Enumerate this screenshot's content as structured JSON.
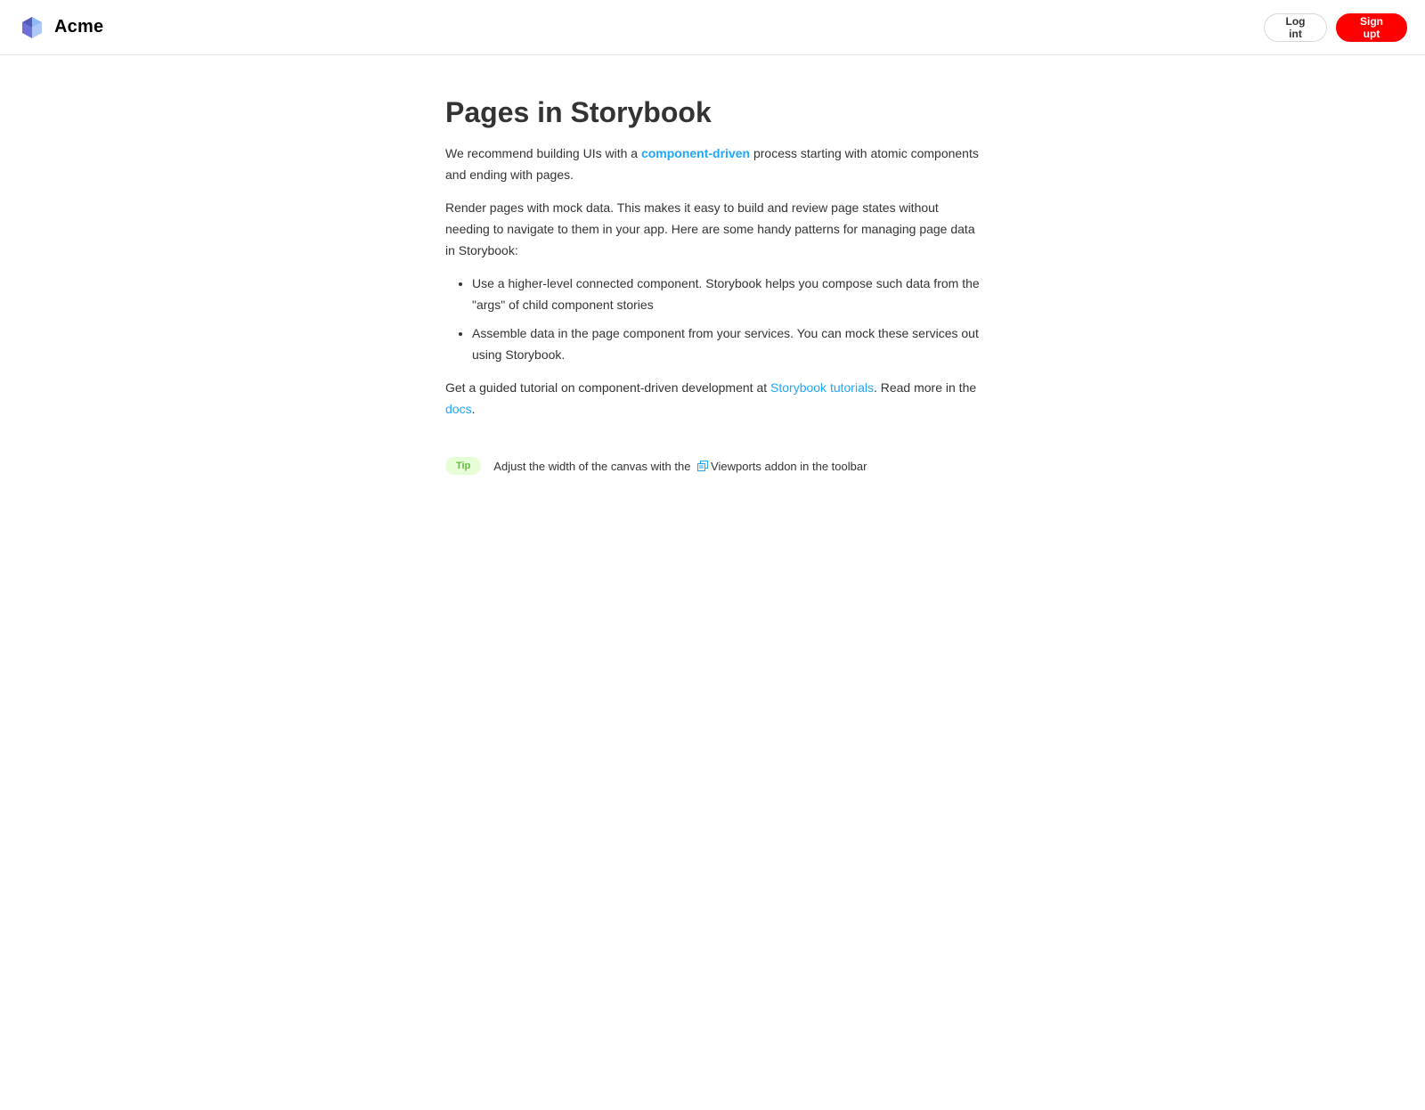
{
  "header": {
    "brand": "Acme",
    "logo_icon": "acme-cube-logo",
    "login_label": "Log int",
    "signup_label": "Sign upt"
  },
  "main": {
    "title": "Pages in Storybook",
    "intro": {
      "before": "We recommend building UIs with a ",
      "link": "component-driven",
      "after": " process starting with atomic components and ending with pages."
    },
    "paragraph2": "Render pages with mock data. This makes it easy to build and review page states without needing to navigate to them in your app. Here are some handy patterns for managing page data in Storybook:",
    "bullets": [
      "Use a higher-level connected component. Storybook helps you compose such data from the \"args\" of child component stories",
      "Assemble data in the page component from your services. You can mock these services out using Storybook."
    ],
    "outro": {
      "before": "Get a guided tutorial on component-driven development at ",
      "link1": "Storybook tutorials",
      "middle": ". Read more in the ",
      "link2": "docs",
      "after": "."
    },
    "tip": {
      "badge": "Tip",
      "before": "Adjust the width of the canvas with the ",
      "icon": "viewport-icon",
      "after": "Viewports addon in the toolbar"
    }
  },
  "colors": {
    "brand_red": "#ff0000",
    "link_blue": "#1ea7fd",
    "tip_green": "#66bf3c",
    "tip_bg": "#e7fdd8"
  }
}
